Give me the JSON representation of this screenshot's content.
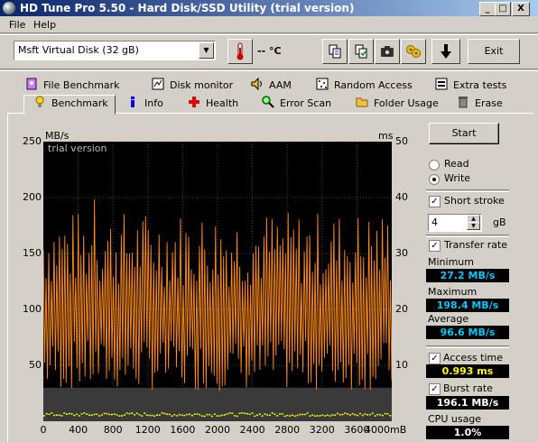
{
  "window": {
    "title": "HD Tune Pro 5.50 - Hard Disk/SSD Utility (trial version)",
    "min": "_",
    "max": "□",
    "close": "X"
  },
  "menu": {
    "file": "File",
    "help": "Help"
  },
  "toolbar": {
    "drive": "Msft    Virtual Disk (32 gB)",
    "temperature": "-- °C",
    "exit": "Exit"
  },
  "tabs_top": [
    "File Benchmark",
    "Disk monitor",
    "AAM",
    "Random Access",
    "Extra tests"
  ],
  "tabs_bottom": [
    "Benchmark",
    "Info",
    "Health",
    "Error Scan",
    "Folder Usage",
    "Erase"
  ],
  "controls": {
    "start": "Start",
    "read": "Read",
    "write": "Write",
    "mode_selected": "write",
    "short_stroke_label": "Short stroke",
    "short_stroke_value": "4",
    "short_stroke_unit": "gB",
    "transfer_rate_label": "Transfer rate",
    "minimum_label": "Minimum",
    "minimum_value": "27.2 MB/s",
    "maximum_label": "Maximum",
    "maximum_value": "198.4 MB/s",
    "average_label": "Average",
    "average_value": "96.6 MB/s",
    "access_time_label": "Access time",
    "access_time_value": "0.993 ms",
    "burst_rate_label": "Burst rate",
    "burst_rate_value": "196.1 MB/s",
    "cpu_usage_label": "CPU usage",
    "cpu_usage_value": "1.0%"
  },
  "colors": {
    "transfer": "#ff8c1a",
    "access": "#ffff00",
    "minimum_text": "#00c8ff",
    "access_text": "#ffff00",
    "cpu_text": "#ffffff"
  },
  "chart_data": {
    "type": "line",
    "left_unit": "MB/s",
    "right_unit": "ms",
    "watermark": "trial version",
    "x_ticks": [
      "0",
      "400",
      "800",
      "1200",
      "1600",
      "2000",
      "2400",
      "2800",
      "3200",
      "3600",
      "4000mB"
    ],
    "y_left_ticks": [
      "250",
      "200",
      "150",
      "100",
      "50"
    ],
    "y_right_ticks": [
      "50",
      "40",
      "30",
      "20",
      "10"
    ],
    "ylim_left": [
      0,
      250
    ],
    "ylim_right": [
      0,
      50
    ],
    "xlim": [
      0,
      4000
    ],
    "series": [
      {
        "name": "Transfer rate",
        "axis": "left",
        "min": 27.2,
        "max": 198.4,
        "average": 96.6
      },
      {
        "name": "Access time",
        "axis": "right",
        "average": 0.993
      }
    ]
  }
}
